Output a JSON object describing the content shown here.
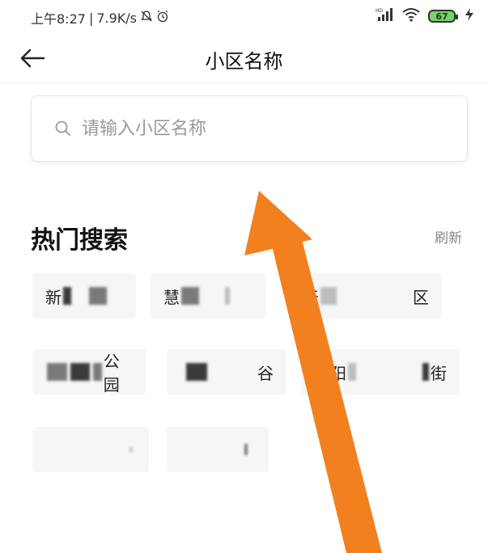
{
  "status_bar": {
    "time": "上午8:27",
    "speed": "7.9K/s",
    "battery": "67"
  },
  "nav": {
    "title": "小区名称"
  },
  "search": {
    "placeholder": "请输入小区名称"
  },
  "hot": {
    "title": "热门搜索",
    "refresh": "刷新",
    "tags": [
      {
        "visible_text": "新"
      },
      {
        "visible_text": "慧"
      },
      {
        "visible_text_start": "天",
        "visible_text_end": "区"
      },
      {
        "visible_text": "公园"
      },
      {
        "visible_text": "谷"
      },
      {
        "visible_text_start": "朝阳",
        "visible_text_end": "街"
      },
      {
        "visible_text": ""
      },
      {
        "visible_text": ""
      }
    ]
  },
  "colors": {
    "arrow": "#f2801f",
    "tag_bg": "#f6f6f6",
    "battery_fill": "#7bd16c"
  },
  "icons": [
    "back-arrow-icon",
    "search-icon",
    "signal-icon",
    "wifi-icon",
    "battery-icon",
    "charging-icon",
    "alarm-icon"
  ]
}
